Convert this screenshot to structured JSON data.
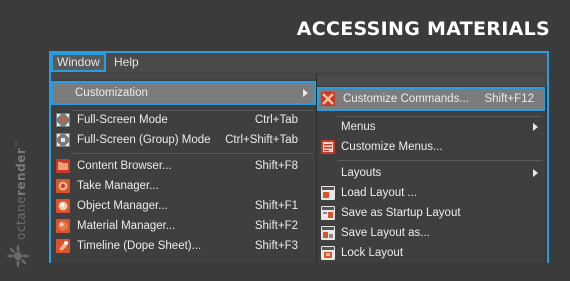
{
  "header": {
    "title": "ACCESSING MATERIALS"
  },
  "branding": {
    "text_light": "octane",
    "text_bold": "render",
    "trademark": "™"
  },
  "menubar": {
    "items": [
      {
        "label": "Window"
      },
      {
        "label": "Help"
      }
    ]
  },
  "window_menu": {
    "items": [
      {
        "label": "Customization",
        "shortcut": ""
      },
      {
        "label": "Full-Screen Mode",
        "shortcut": "Ctrl+Tab"
      },
      {
        "label": "Full-Screen (Group) Mode",
        "shortcut": "Ctrl+Shift+Tab"
      },
      {
        "label": "Content Browser...",
        "shortcut": "Shift+F8"
      },
      {
        "label": "Take Manager...",
        "shortcut": ""
      },
      {
        "label": "Object Manager...",
        "shortcut": "Shift+F1"
      },
      {
        "label": "Material Manager...",
        "shortcut": "Shift+F2"
      },
      {
        "label": "Timeline (Dope Sheet)...",
        "shortcut": "Shift+F3"
      }
    ]
  },
  "customization_submenu": {
    "items": [
      {
        "label": "Customize Commands...",
        "shortcut": "Shift+F12"
      },
      {
        "label": "Menus",
        "shortcut": ""
      },
      {
        "label": "Customize Menus...",
        "shortcut": ""
      },
      {
        "label": "Layouts",
        "shortcut": ""
      },
      {
        "label": "Load Layout ...",
        "shortcut": ""
      },
      {
        "label": "Save as Startup Layout",
        "shortcut": ""
      },
      {
        "label": "Save Layout as...",
        "shortcut": ""
      },
      {
        "label": "Lock Layout",
        "shortcut": ""
      }
    ]
  },
  "colors": {
    "highlight_border": "#2a9de0",
    "menu_bg": "#3f3f3f",
    "selected_bg": "#7c7c7c",
    "icon_orange": "#d9532c",
    "icon_red": "#c63a2a",
    "text": "#ececec",
    "title_text": "#ffffff"
  },
  "icons": {
    "fullscreen": "fullscreen-arrows-icon",
    "content_browser": "folder-icon",
    "take_manager": "clapper-icon",
    "object_manager": "cube-icon",
    "material_manager": "sphere-icon",
    "timeline": "keyframe-icon",
    "customize_commands": "gear-cross-icon",
    "customize_menus": "menu-list-icon",
    "layout": "layout-window-icon"
  }
}
